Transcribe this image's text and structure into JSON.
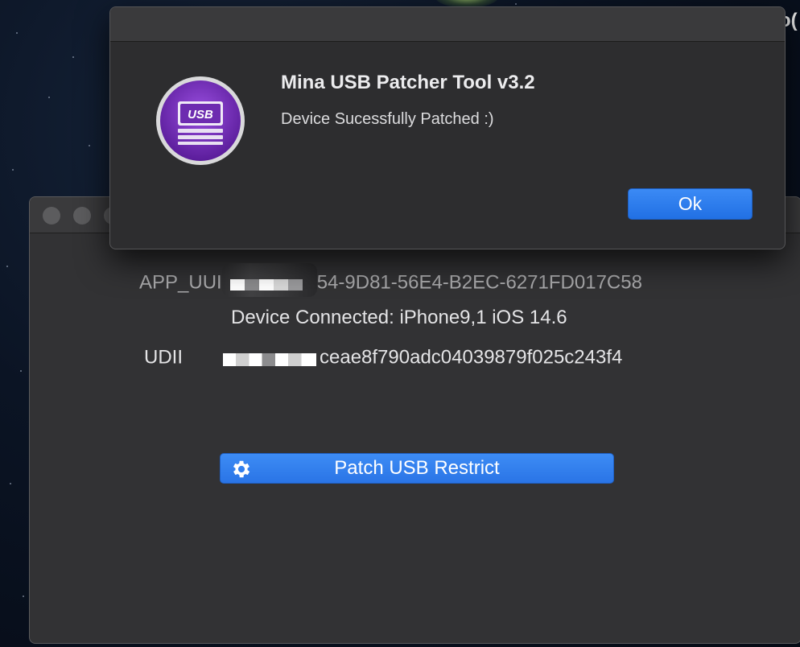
{
  "desktop": {
    "partial_text": "o("
  },
  "main_window": {
    "app_uuid_prefix": "APP_UUI",
    "app_uuid_suffix": "54-9D81-56E4-B2EC-6271FD017C58",
    "device_connected": "Device Connected: iPhone9,1 iOS 14.6",
    "udid_prefix": "UDII",
    "udid_suffix": "ceae8f790adc04039879f025c243f4",
    "patch_button_label": "Patch USB Restrict",
    "patch_button_icon": "gear-icon"
  },
  "alert": {
    "title": "Mina USB Patcher Tool v3.2",
    "message": "Device Sucessfully Patched :)",
    "ok_label": "Ok",
    "icon_text": "USB",
    "icon_name": "usb-drive-icon"
  },
  "colors": {
    "accent": "#2a74e6",
    "window_bg": "#323234",
    "icon_purple": "#7b2fbf"
  }
}
